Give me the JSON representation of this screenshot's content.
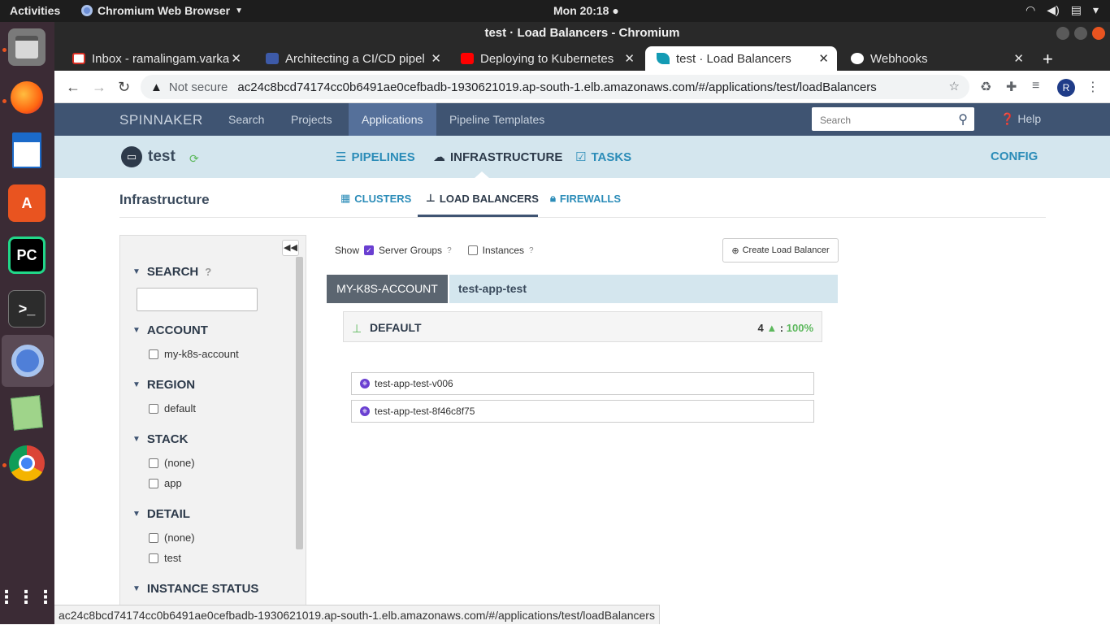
{
  "desktop": {
    "activities": "Activities",
    "app_name": "Chromium Web Browser",
    "clock": "Mon 20:18"
  },
  "window": {
    "title": "test · Load Balancers - Chromium"
  },
  "tabs": [
    {
      "title": "Inbox - ramalingam.varka",
      "favicon": "gmail-icon",
      "color": "#d93025"
    },
    {
      "title": "Architecting a CI/CD pipel",
      "favicon": "coursera-icon",
      "color": "#3d5aa8"
    },
    {
      "title": "Deploying to Kubernetes",
      "favicon": "youtube-icon",
      "color": "#ff0000"
    },
    {
      "title": "test · Load Balancers",
      "favicon": "spinnaker-icon",
      "color": "#139bb4"
    },
    {
      "title": "Webhooks",
      "favicon": "github-icon",
      "color": "#ffffff"
    }
  ],
  "address": {
    "security": "Not secure",
    "url": "ac24c8bcd74174cc0b6491ae0cefbadb-1930621019.ap-south-1.elb.amazonaws.com/#/applications/test/loadBalancers",
    "profile": "R"
  },
  "spinnaker": {
    "brand": "SPINNAKER",
    "nav": [
      "Search",
      "Projects",
      "Applications",
      "Pipeline Templates"
    ],
    "search_placeholder": "Search",
    "help": "Help"
  },
  "app": {
    "name": "test",
    "menu": {
      "pipelines": "PIPELINES",
      "infrastructure": "INFRASTRUCTURE",
      "tasks": "TASKS",
      "config": "CONFIG"
    }
  },
  "infrastructure": {
    "heading": "Infrastructure",
    "tabs": {
      "clusters": "CLUSTERS",
      "load_balancers": "LOAD BALANCERS",
      "firewalls": "FIREWALLS"
    }
  },
  "filters": {
    "search": "SEARCH",
    "account": {
      "label": "ACCOUNT",
      "options": [
        "my-k8s-account"
      ]
    },
    "region": {
      "label": "REGION",
      "options": [
        "default"
      ]
    },
    "stack": {
      "label": "STACK",
      "options": [
        "(none)",
        "app"
      ]
    },
    "detail": {
      "label": "DETAIL",
      "options": [
        "(none)",
        "test"
      ]
    },
    "instance_status": "INSTANCE STATUS"
  },
  "content": {
    "show": "Show",
    "server_groups": "Server Groups",
    "server_groups_checked": true,
    "instances": "Instances",
    "instances_checked": false,
    "create_button": "Create Load Balancer",
    "account": "MY-K8S-ACCOUNT",
    "load_balancer": "test-app-test",
    "group": {
      "name": "DEFAULT",
      "count": "4",
      "health": "100%"
    },
    "server_groups_list": [
      "test-app-test-v006",
      "test-app-test-8f46c8f75"
    ]
  },
  "status_bar": "ac24c8bcd74174cc0b6491ae0cefbadb-1930621019.ap-south-1.elb.amazonaws.com/#/applications/test/loadBalancers"
}
